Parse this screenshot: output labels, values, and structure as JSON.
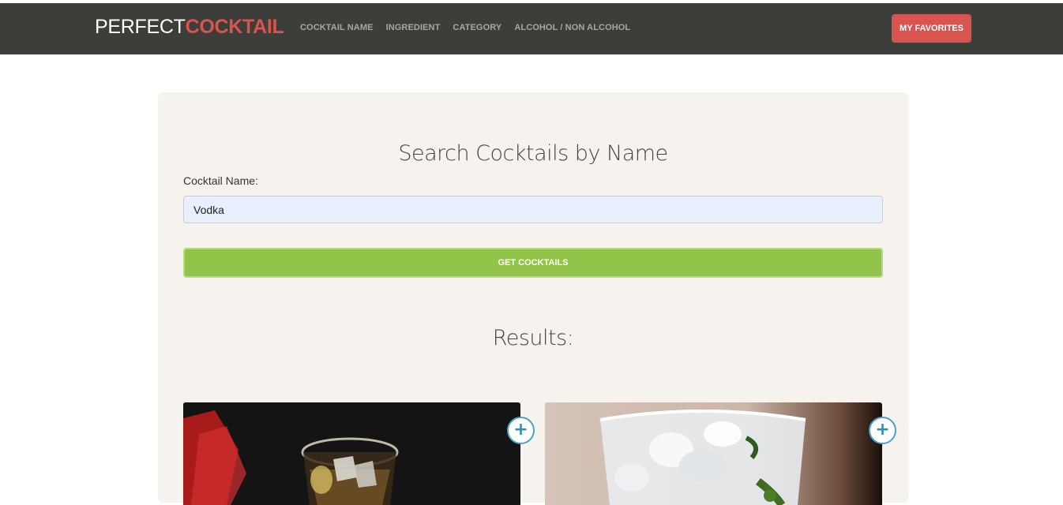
{
  "brand": {
    "light": "PERFECT",
    "bold": "COCKTAIL"
  },
  "nav": {
    "items": [
      {
        "label": "COCKTAIL NAME"
      },
      {
        "label": "INGREDIENT"
      },
      {
        "label": "CATEGORY"
      },
      {
        "label": "ALCOHOL / NON ALCOHOL"
      }
    ],
    "favorites_label": "MY FAVORITES"
  },
  "search": {
    "title": "Search Cocktails by Name",
    "label": "Cocktail Name:",
    "value": "Vodka",
    "button_label": "GET COCKTAILS"
  },
  "results": {
    "title": "Results:",
    "cards": [
      {
        "add_label": "+"
      },
      {
        "add_label": "+"
      }
    ]
  },
  "colors": {
    "navbar": "#3d3d39",
    "accent_red": "#d9534f",
    "button_green": "#92c44a",
    "panel": "#f6f3ef",
    "add_blue": "#4aa3c3"
  }
}
